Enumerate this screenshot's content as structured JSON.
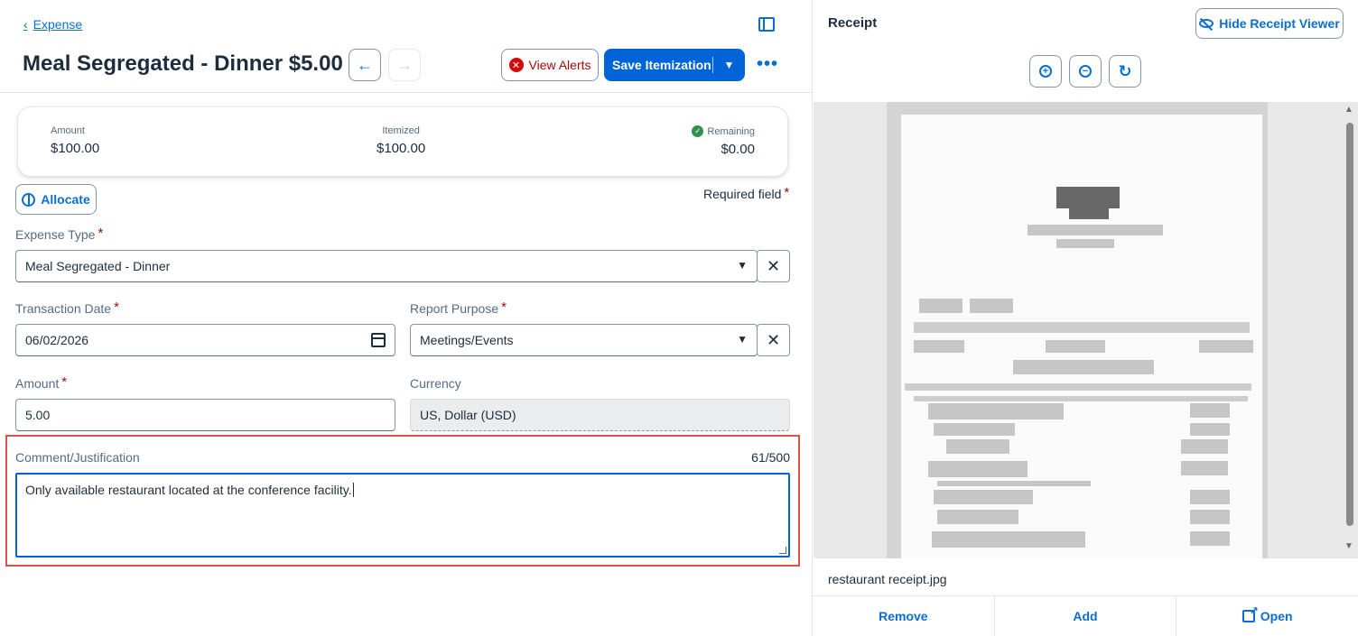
{
  "header": {
    "back_label": "Expense",
    "title": "Meal Segregated - Dinner $5.00",
    "view_alerts_label": "View Alerts",
    "save_label": "Save Itemization"
  },
  "summary": {
    "amount_label": "Amount",
    "amount_value": "$100.00",
    "itemized_label": "Itemized",
    "itemized_value": "$100.00",
    "remaining_label": "Remaining",
    "remaining_value": "$0.00"
  },
  "form": {
    "allocate_label": "Allocate",
    "required_note": "Required field",
    "required_marker": "*",
    "expense_type_label": "Expense Type",
    "expense_type_value": "Meal Segregated - Dinner",
    "transaction_date_label": "Transaction Date",
    "transaction_date_value": "06/02/2026",
    "report_purpose_label": "Report Purpose",
    "report_purpose_value": "Meetings/Events",
    "amount_label": "Amount",
    "amount_value": "5.00",
    "currency_label": "Currency",
    "currency_value": "US, Dollar (USD)",
    "comment_label": "Comment/Justification",
    "comment_count": "61/500",
    "comment_value": "Only available restaurant located at the conference facility."
  },
  "receipt": {
    "title": "Receipt",
    "hide_viewer_label": "Hide Receipt Viewer",
    "filename": "restaurant receipt.jpg",
    "remove_label": "Remove",
    "add_label": "Add",
    "open_label": "Open"
  },
  "colors": {
    "accent": "#0064d9",
    "error": "#d20a0a",
    "success": "#30914c",
    "highlight_border": "#d9534f"
  }
}
